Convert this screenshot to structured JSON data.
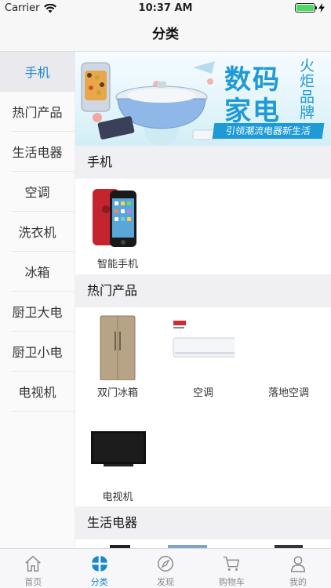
{
  "status_bar": {
    "carrier": "Carrier",
    "time": "10:37 AM"
  },
  "nav": {
    "title": "分类"
  },
  "sidebar": {
    "items": [
      {
        "label": "手机"
      },
      {
        "label": "热门产品"
      },
      {
        "label": "生活电器"
      },
      {
        "label": "空调"
      },
      {
        "label": "洗衣机"
      },
      {
        "label": "冰箱"
      },
      {
        "label": "厨卫大电"
      },
      {
        "label": "厨卫小电"
      },
      {
        "label": "电视机"
      }
    ]
  },
  "banner": {
    "headline_1": "数码",
    "headline_2": "家电",
    "side_text": "火炬品牌",
    "tagline": "引领潮流电器新生活"
  },
  "sections": [
    {
      "title": "手机",
      "products": [
        {
          "name": "智能手机"
        }
      ]
    },
    {
      "title": "热门产品",
      "products": [
        {
          "name": "双门冰箱"
        },
        {
          "name": "空调"
        },
        {
          "name": "落地空调"
        },
        {
          "name": "电视机"
        }
      ]
    },
    {
      "title": "生活电器",
      "products": []
    }
  ],
  "tab_bar": {
    "tabs": [
      {
        "label": "首页",
        "icon": "home-icon"
      },
      {
        "label": "分类",
        "icon": "category-icon"
      },
      {
        "label": "发现",
        "icon": "compass-icon"
      },
      {
        "label": "购物车",
        "icon": "cart-icon"
      },
      {
        "label": "我的",
        "icon": "profile-icon"
      }
    ]
  },
  "colors": {
    "accent": "#1688cc",
    "battery": "#4cd964",
    "banner_text": "#1e9ad6"
  }
}
